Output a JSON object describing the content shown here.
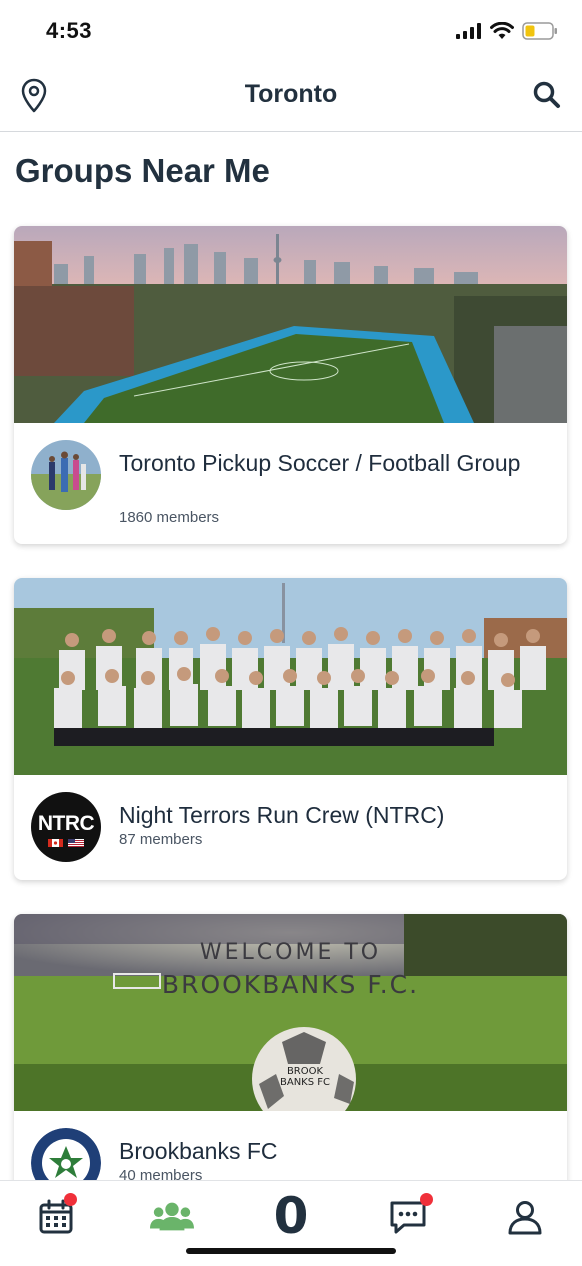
{
  "status_bar": {
    "time": "4:53"
  },
  "nav": {
    "title": "Toronto"
  },
  "page": {
    "title": "Groups Near Me"
  },
  "groups": [
    {
      "name": "Toronto Pickup Soccer / Football Group",
      "members": "1860 members"
    },
    {
      "name": "Night Terrors Run Crew (NTRC)",
      "members": "87 members",
      "avatar_text": "NTRC"
    },
    {
      "name": "Brookbanks FC",
      "members": "40 members",
      "banner_line1": "WELCOME TO",
      "banner_line2": "BROOKBANKS F.C.",
      "ball_text": "BROOK BANKS FC"
    }
  ],
  "tabs": [
    {
      "icon": "calendar-icon",
      "badge": true
    },
    {
      "icon": "groups-icon",
      "badge": false,
      "active": true
    },
    {
      "icon": "logo-icon",
      "label": "0",
      "badge": false
    },
    {
      "icon": "chat-icon",
      "badge": true
    },
    {
      "icon": "profile-icon",
      "badge": false
    }
  ],
  "colors": {
    "accent_green": "#6ab46a",
    "badge_red": "#f0303a",
    "text_dark": "#22313f"
  }
}
